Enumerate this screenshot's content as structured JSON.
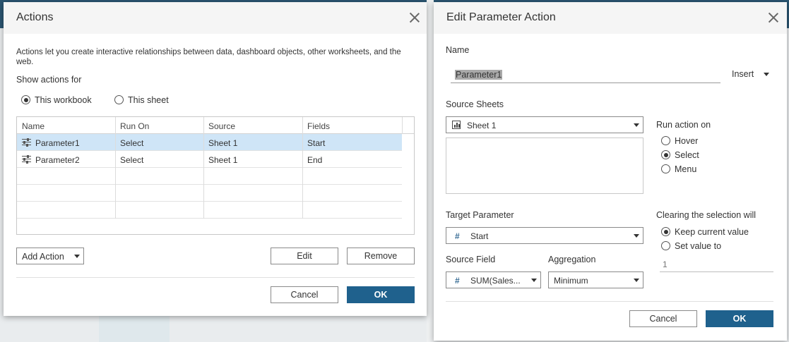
{
  "actions_dialog": {
    "title": "Actions",
    "description": "Actions let you create interactive relationships between data, dashboard objects, other worksheets, and the web.",
    "show_actions_for_label": "Show actions for",
    "scope_options": [
      {
        "label": "This workbook",
        "checked": true
      },
      {
        "label": "This sheet",
        "checked": false
      }
    ],
    "table": {
      "columns": [
        "Name",
        "Run On",
        "Source",
        "Fields"
      ],
      "rows": [
        {
          "name": "Parameter1",
          "run_on": "Select",
          "source": "Sheet 1",
          "fields": "Start",
          "selected": true
        },
        {
          "name": "Parameter2",
          "run_on": "Select",
          "source": "Sheet 1",
          "fields": "End",
          "selected": false
        }
      ]
    },
    "buttons": {
      "add_action": "Add Action",
      "edit": "Edit",
      "remove": "Remove",
      "cancel": "Cancel",
      "ok": "OK"
    }
  },
  "edit_dialog": {
    "title": "Edit Parameter Action",
    "name_label": "Name",
    "name_value": "Parameter1",
    "insert_label": "Insert",
    "source_sheets_label": "Source Sheets",
    "source_sheet_value": "Sheet 1",
    "run_action_on_label": "Run action on",
    "run_options": [
      {
        "label": "Hover",
        "checked": false
      },
      {
        "label": "Select",
        "checked": true
      },
      {
        "label": "Menu",
        "checked": false
      }
    ],
    "target_parameter_label": "Target Parameter",
    "target_parameter_value": "Start",
    "clearing_label": "Clearing the selection will",
    "clearing_options": [
      {
        "label": "Keep current value",
        "checked": true
      },
      {
        "label": "Set value to",
        "checked": false
      }
    ],
    "set_value_placeholder": "1",
    "source_field_label": "Source Field",
    "source_field_value": "SUM(Sales...",
    "aggregation_label": "Aggregation",
    "aggregation_value": "Minimum",
    "buttons": {
      "cancel": "Cancel",
      "ok": "OK"
    }
  },
  "colors": {
    "primary_button": "#1f618d",
    "selected_row": "#cfe5f7",
    "header_bg": "#f5f5f5",
    "app_topbar": "#2b5571"
  }
}
